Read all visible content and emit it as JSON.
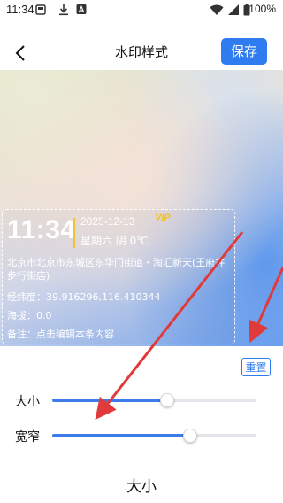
{
  "status_bar": {
    "time": "11:34",
    "battery": "100%"
  },
  "nav": {
    "title": "水印样式",
    "save_label": "保存"
  },
  "watermark": {
    "time": "11:34",
    "date": "2025-12-13",
    "vip": "VIP",
    "weather": "星期六  阴 0℃",
    "address": "北京市北京市东城区东华门街道・淘汇新天(王府井步行街店)",
    "coordinates": "经纬度：39.916296,116.410344",
    "altitude": "海拔：0.0",
    "note": "备注：点击编辑本条内容"
  },
  "controls": {
    "reset_label": "重置",
    "size_label": "大小",
    "size_value": 0.56,
    "width_label": "宽窄",
    "width_value": 0.67,
    "tab_label": "大小"
  },
  "colors": {
    "accent": "#2f7bf0",
    "arrow": "#e03a3a",
    "vip": "#f0c020"
  }
}
